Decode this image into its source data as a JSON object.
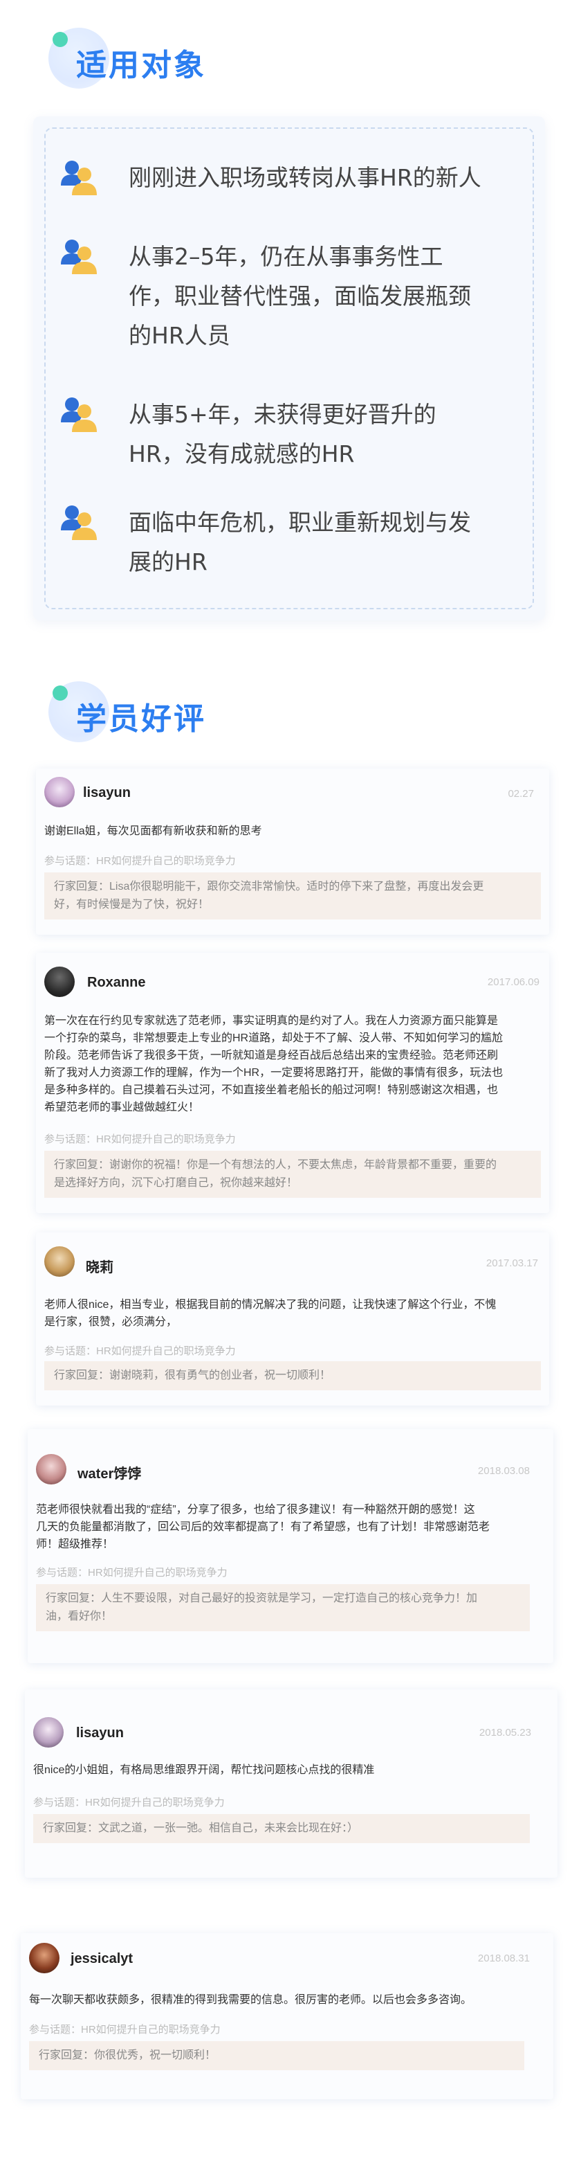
{
  "audience": {
    "title": "适用对象",
    "items": [
      "刚刚进入职场或转岗从事HR的新人",
      "从事2–5年，仍在从事事务性工作，职业替代性强，面临发展瓶颈的HR人员",
      "从事5+年，未获得更好晋升的HR，没有成就感的HR",
      "面临中年危机，职业重新规划与发展的HR"
    ],
    "item_lines": [
      [
        "刚刚进入职场或转岗从事HR的新人"
      ],
      [
        "从事2–5年，仍在从事事务性工",
        "作，职业替代性强，面临发展瓶颈",
        "的HR人员"
      ],
      [
        "从事5+年，未获得更好晋升的",
        "HR，没有成就感的HR"
      ],
      [
        "面临中年危机，职业重新规划与发",
        "展的HR"
      ]
    ]
  },
  "reviews": {
    "title": "学员好评",
    "topic_prefix": "参与话题：",
    "topic": "HR如何提升自己的职场竞争力",
    "reply_prefix": "行家回复：",
    "items": [
      {
        "name": "lisayun",
        "date": "02.27",
        "text": [
          "谢谢Ella姐，每次见面都有新收获和新的思考"
        ],
        "reply": [
          "行家回复：Lisa你很聪明能干，跟你交流非常愉快。适时的停下来了盘整，再度出发会更",
          "好，有时候慢是为了快，祝好！"
        ]
      },
      {
        "name": "Roxanne",
        "date": "2017.06.09",
        "text": [
          "第一次在在行约见专家就选了范老师，事实证明真的是约对了人。我在人力资源方面只能算是",
          "一个打杂的菜鸟，非常想要走上专业的HR道路，却处于不了解、没人带、不知如何学习的尴尬",
          "阶段。范老师告诉了我很多干货，一听就知道是身经百战后总结出来的宝贵经验。范老师还刷",
          "新了我对人力资源工作的理解，作为一个HR，一定要将思路打开，能做的事情有很多，玩法也",
          "是多种多样的。自己摸着石头过河，不如直接坐着老船长的船过河啊！特别感谢这次相遇，也",
          "希望范老师的事业越做越红火！"
        ],
        "reply": [
          "行家回复：谢谢你的祝福！你是一个有想法的人，不要太焦虑，年龄背景都不重要，重要的",
          "是选择好方向，沉下心打磨自己，祝你越来越好！"
        ]
      },
      {
        "name": "晓莉",
        "date": "2017.03.17",
        "text": [
          "老师人很nice，相当专业，根据我目前的情况解决了我的问题，让我快速了解这个行业，不愧",
          "是行家，很赞，必须满分，"
        ],
        "reply": [
          "行家回复：谢谢晓莉，很有勇气的创业者，祝一切顺利！"
        ]
      },
      {
        "name": "water饽饽",
        "date": "2018.03.08",
        "text": [
          "范老师很快就看出我的“症结”，分享了很多，也给了很多建议！有一种豁然开朗的感觉！这",
          "几天的负能量都消散了，回公司后的效率都提高了！有了希望感，也有了计划！非常感谢范老",
          "师！超级推荐！"
        ],
        "reply": [
          "行家回复：人生不要设限，对自己最好的投资就是学习，一定打造自己的核心竞争力！加",
          "油，看好你！"
        ]
      },
      {
        "name": "lisayun",
        "date": "2018.05.23",
        "text": [
          "很nice的小姐姐，有格局思维跟界开阔，帮忙找问题核心点找的很精准"
        ],
        "reply": [
          "行家回复：文武之道，一张一弛。相信自己，未来会比现在好：）"
        ]
      },
      {
        "name": "jessicalyt",
        "date": "2018.08.31",
        "text": [
          "每一次聊天都收获颇多，很精准的得到我需要的信息。很厉害的老师。以后也会多多咨询。"
        ],
        "reply": [
          "行家回复：你很优秀，祝一切顺利！"
        ]
      }
    ]
  },
  "colors": {
    "accent": "#2c7ef0",
    "dot": "#4fd6b7",
    "icon_person_blue": "#2f6fd6",
    "icon_person_yellow": "#f5c14e",
    "reply_bg": "#f6efea"
  },
  "icons": {
    "audience_item": "user-pair-icon"
  }
}
